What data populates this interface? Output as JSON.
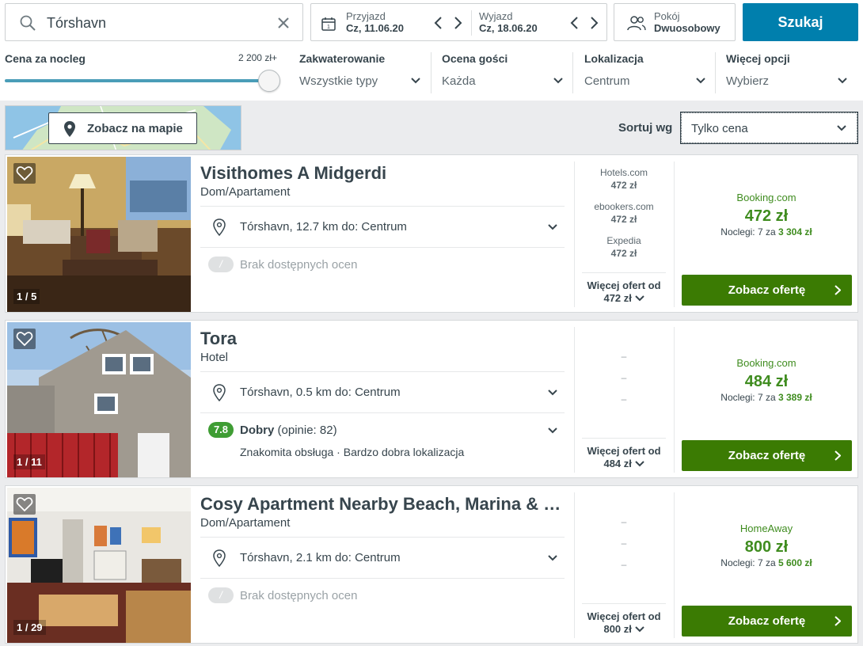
{
  "search": {
    "value": "Tórshavn"
  },
  "dates": {
    "checkin_label": "Przyjazd",
    "checkin_value": "Cz, 11.06.20",
    "checkout_label": "Wyjazd",
    "checkout_value": "Cz, 18.06.20"
  },
  "room": {
    "label": "Pokój",
    "value": "Dwuosobowy"
  },
  "search_button": "Szukaj",
  "filters": {
    "price_label": "Cena za nocleg",
    "price_value": "2 200 zł+",
    "price_fraction": 1.0,
    "accommodation_label": "Zakwaterowanie",
    "accommodation_value": "Wszystkie typy",
    "rating_label": "Ocena gości",
    "rating_value": "Każda",
    "location_label": "Lokalizacja",
    "location_value": "Centrum",
    "more_label": "Więcej opcji",
    "more_value": "Wybierz"
  },
  "map_button": "Zobacz na mapie",
  "sort": {
    "label": "Sortuj wg",
    "value": "Tylko cena"
  },
  "colors": {
    "accent_blue": "#007fad",
    "deal_green": "#3b7b03",
    "price_green": "#3f8c1f",
    "rating_green": "#3f9d34"
  },
  "results": [
    {
      "name": "Visithomes A Midgerdi",
      "type": "Dom/Apartament",
      "location": "Tórshavn, 12.7 km do: Centrum",
      "rating_none": "Brak dostępnych ocen",
      "rating_none_icon": "/",
      "counter": "1 / 5",
      "partners": [
        {
          "site": "Hotels.com",
          "price": "472 zł"
        },
        {
          "site": "ebookers.com",
          "price": "472 zł"
        },
        {
          "site": "Expedia",
          "price": "472 zł"
        }
      ],
      "more_label": "Więcej ofert od",
      "more_price": "472 zł",
      "deal_site": "Booking.com",
      "deal_price": "472 zł",
      "nights_text": "Noclegi: 7 za",
      "nights_total": "3 304 zł",
      "cta": "Zobacz ofertę"
    },
    {
      "name": "Tora",
      "type": "Hotel",
      "location": "Tórshavn, 0.5 km do: Centrum",
      "rating_score": "7.8",
      "rating_word": "Dobry",
      "rating_count": "(opinie: 82)",
      "rating_highlights": "Znakomita obsługa · Bardzo dobra lokalizacja",
      "counter": "1 / 11",
      "dashes": [
        "–",
        "–",
        "–"
      ],
      "more_label": "Więcej ofert od",
      "more_price": "484 zł",
      "deal_site": "Booking.com",
      "deal_price": "484 zł",
      "nights_text": "Noclegi: 7 za",
      "nights_total": "3 389 zł",
      "cta": "Zobacz ofertę"
    },
    {
      "name": "Cosy Apartment Nearby Beach, Marina & …",
      "type": "Dom/Apartament",
      "location": "Tórshavn, 2.1 km do: Centrum",
      "rating_none": "Brak dostępnych ocen",
      "rating_none_icon": "/",
      "counter": "1 / 29",
      "dashes": [
        "–",
        "–",
        "–"
      ],
      "more_label": "Więcej ofert od",
      "more_price": "800 zł",
      "deal_site": "HomeAway",
      "deal_price": "800 zł",
      "nights_text": "Noclegi: 7 za",
      "nights_total": "5 600 zł",
      "cta": "Zobacz ofertę"
    }
  ]
}
